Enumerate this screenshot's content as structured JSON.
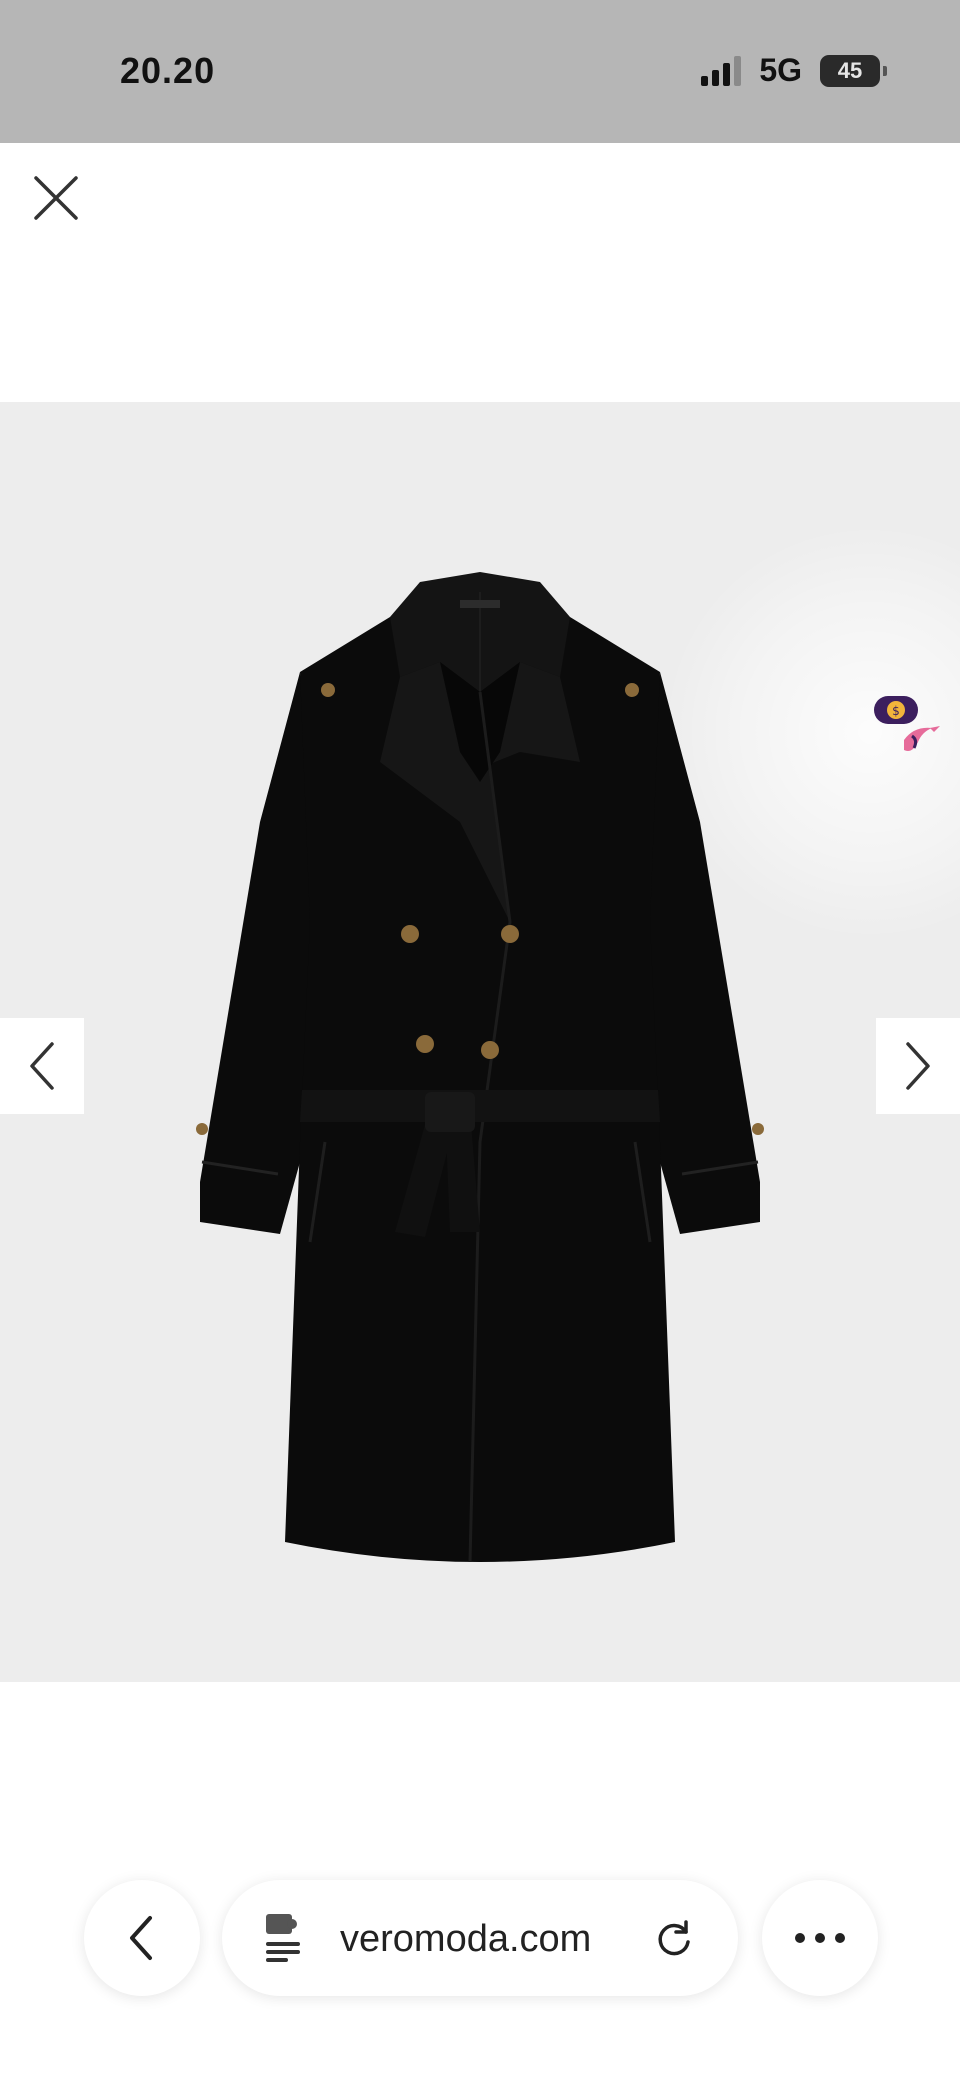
{
  "status_bar": {
    "time": "20.20",
    "network": "5G",
    "battery": "45"
  },
  "product_viewer": {
    "close_label": "",
    "prev_label": "",
    "next_label": ""
  },
  "browser": {
    "url": "veromoda.com"
  },
  "colors": {
    "status_bar_bg": "#b6b6b6",
    "image_bg": "#ededed",
    "coat": "#0b0b0b",
    "badge_purple": "#3c1f5e",
    "badge_gold": "#f2b53b",
    "bird_pink": "#e66b9a"
  },
  "icons": {
    "close": "close-icon",
    "prev": "chevron-left-icon",
    "next": "chevron-right-icon",
    "back": "chevron-left-icon",
    "site": "puzzle-doc-icon",
    "reload": "reload-icon",
    "more": "more-dots-icon"
  }
}
